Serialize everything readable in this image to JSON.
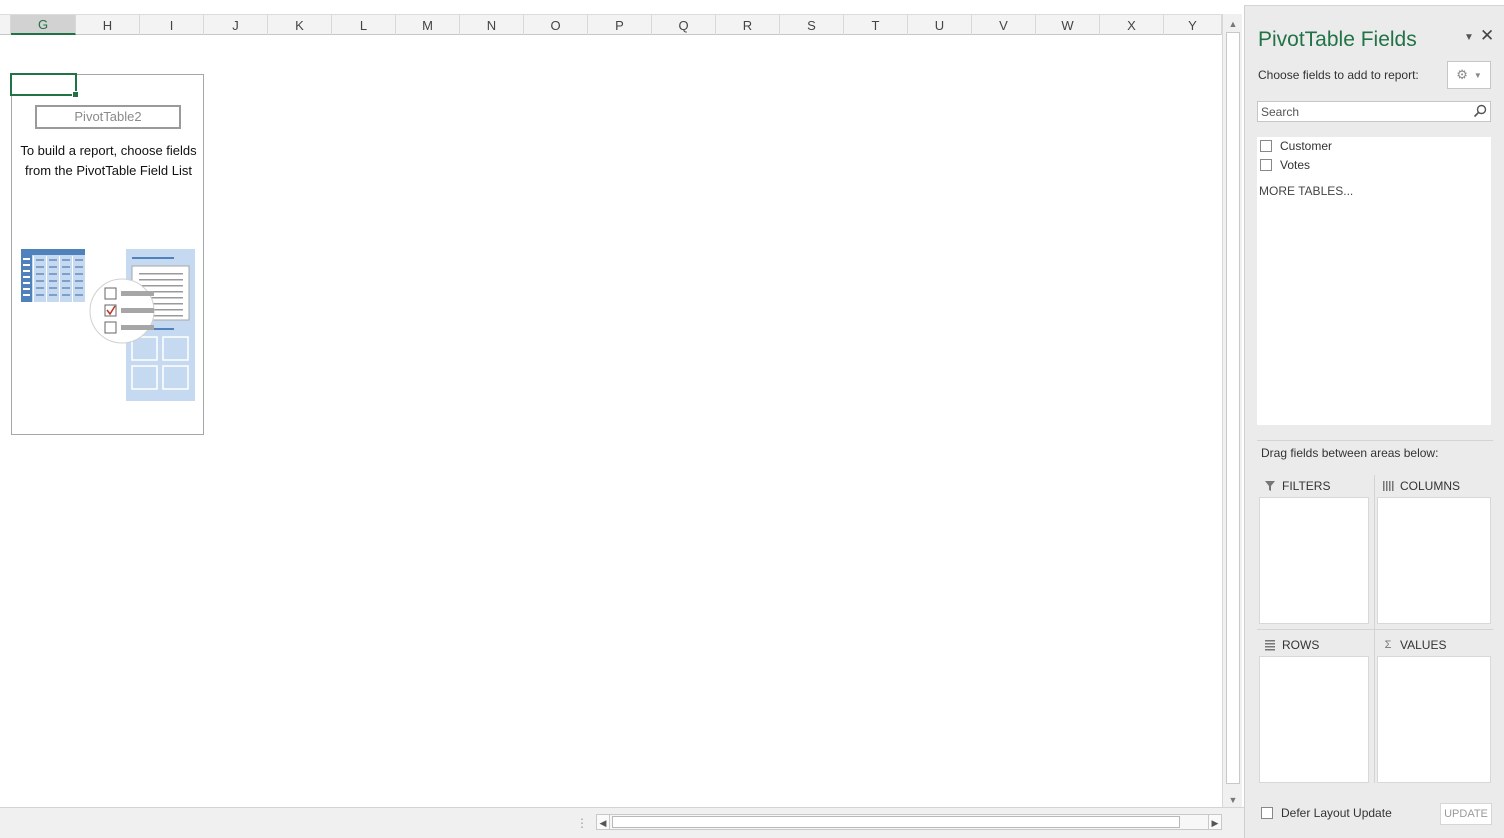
{
  "columns": [
    "G",
    "H",
    "I",
    "J",
    "K",
    "L",
    "M",
    "N",
    "O",
    "P",
    "Q",
    "R",
    "S",
    "T",
    "U",
    "V",
    "W",
    "X",
    "Y"
  ],
  "selected_column": "G",
  "pivot_placeholder": {
    "name": "PivotTable2",
    "message": "To build a report, choose fields from the PivotTable Field List"
  },
  "field_pane": {
    "title": "PivotTable Fields",
    "choose_label": "Choose fields to add to report:",
    "search_placeholder": "Search",
    "fields": [
      {
        "label": "Customer",
        "checked": false
      },
      {
        "label": "Votes",
        "checked": false
      }
    ],
    "more_tables": "MORE TABLES...",
    "drag_label": "Drag fields between areas below:",
    "areas": {
      "filters": "FILTERS",
      "columns": "COLUMNS",
      "rows": "ROWS",
      "values": "VALUES"
    },
    "defer_label": "Defer Layout Update",
    "update_label": "UPDATE"
  },
  "icons": {
    "gear": "gear-icon",
    "search": "search-icon",
    "close": "close-icon",
    "dropdown": "chevron-down-icon"
  },
  "colors": {
    "accent": "#217346",
    "pane_bg": "#ebebeb",
    "illus_blue": "#4f81bd",
    "illus_light": "#c5d9f1"
  }
}
